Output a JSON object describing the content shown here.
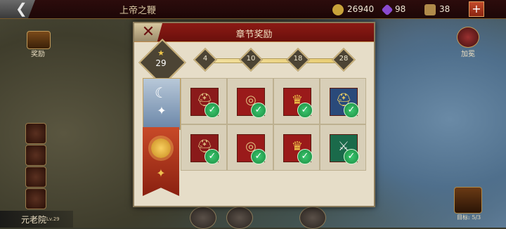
{
  "top_bar": {
    "back_label": "❮",
    "title": "上帝之鞭",
    "resources": [
      {
        "name": "coin",
        "value": "26940",
        "color": "#c9a33a"
      },
      {
        "name": "gem",
        "value": "98",
        "color": "#8a4ad0"
      },
      {
        "name": "food",
        "value": "38",
        "color": "#b08a4a"
      }
    ],
    "plus_label": "+"
  },
  "left_side": {
    "rewards_label": "奖励",
    "senate_label": "元老院",
    "senate_level": "Lv.29"
  },
  "right_side": {
    "crown_label": "加冕",
    "chest_label": "目标: 5/3"
  },
  "dialog": {
    "title": "章节奖励",
    "close_label": "✕",
    "stars": "29",
    "milestones": [
      "4",
      "10",
      "18",
      "28"
    ],
    "tiers": [
      {
        "name": "silver-tier",
        "items": [
          {
            "icon": "helmet-icon",
            "glyph": "⛑",
            "bg": "#8a1a1a",
            "claimed": true
          },
          {
            "icon": "ring-icon",
            "glyph": "◎",
            "bg": "#9a1a1a",
            "claimed": true
          },
          {
            "icon": "crown-icon",
            "glyph": "♛",
            "bg": "#9a1a1a",
            "claimed": true
          },
          {
            "icon": "gold-helmet-icon",
            "glyph": "⛑",
            "bg": "#2a4a7a",
            "claimed": true
          }
        ]
      },
      {
        "name": "gold-tier",
        "items": [
          {
            "icon": "helmet-icon",
            "glyph": "⛑",
            "bg": "#8a1a1a",
            "claimed": true
          },
          {
            "icon": "ring-icon",
            "glyph": "◎",
            "bg": "#9a1a1a",
            "claimed": true
          },
          {
            "icon": "crown-icon",
            "glyph": "♛",
            "bg": "#9a1a1a",
            "claimed": true
          },
          {
            "icon": "armor-icon",
            "glyph": "⚔",
            "bg": "#1a6a4a",
            "claimed": true
          }
        ]
      }
    ]
  }
}
